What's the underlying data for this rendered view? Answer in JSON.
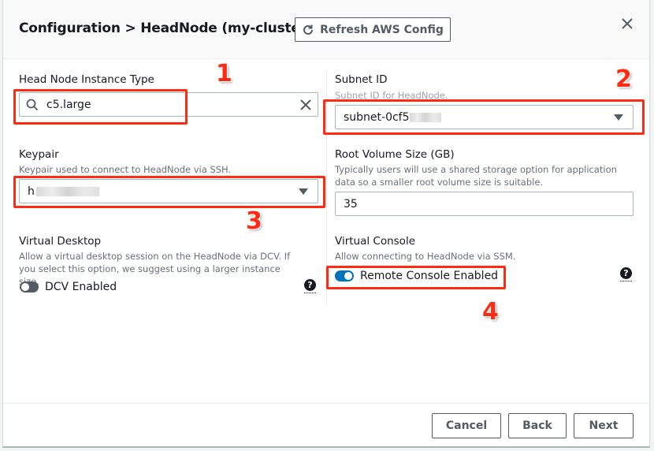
{
  "header": {
    "title": "Configuration > HeadNode (my-cluster)",
    "refresh_label": "Refresh AWS Config"
  },
  "fields": {
    "instance_type": {
      "label": "Head Node Instance Type",
      "value": "c5.large"
    },
    "subnet": {
      "label": "Subnet ID",
      "description": "Subnet ID for HeadNode.",
      "value": "subnet-0cf5"
    },
    "keypair": {
      "label": "Keypair",
      "description": "Keypair used to connect to HeadNode via SSH.",
      "value": "h"
    },
    "root_volume": {
      "label": "Root Volume Size (GB)",
      "description": "Typically users will use a shared storage option for application data so a smaller root volume size is suitable.",
      "value": "35"
    },
    "virtual_desktop": {
      "label": "Virtual Desktop",
      "description": "Allow a virtual desktop session on the HeadNode via DCV. If you select this option, we suggest using a larger instance size.",
      "toggle_label": "DCV Enabled",
      "enabled": false
    },
    "virtual_console": {
      "label": "Virtual Console",
      "description": "Allow connecting to HeadNode via SSM.",
      "toggle_label": "Remote Console Enabled",
      "enabled": true
    }
  },
  "help_icon_glyph": "?",
  "footer": {
    "cancel_label": "Cancel",
    "back_label": "Back",
    "next_label": "Next"
  },
  "annotations": {
    "n1": "1",
    "n2": "2",
    "n3": "3",
    "n4": "4",
    "color": "#ff2a12"
  },
  "colors": {
    "toggle_on": "#0073bb",
    "toggle_off": "#545b64",
    "button_border": "#545b64"
  }
}
